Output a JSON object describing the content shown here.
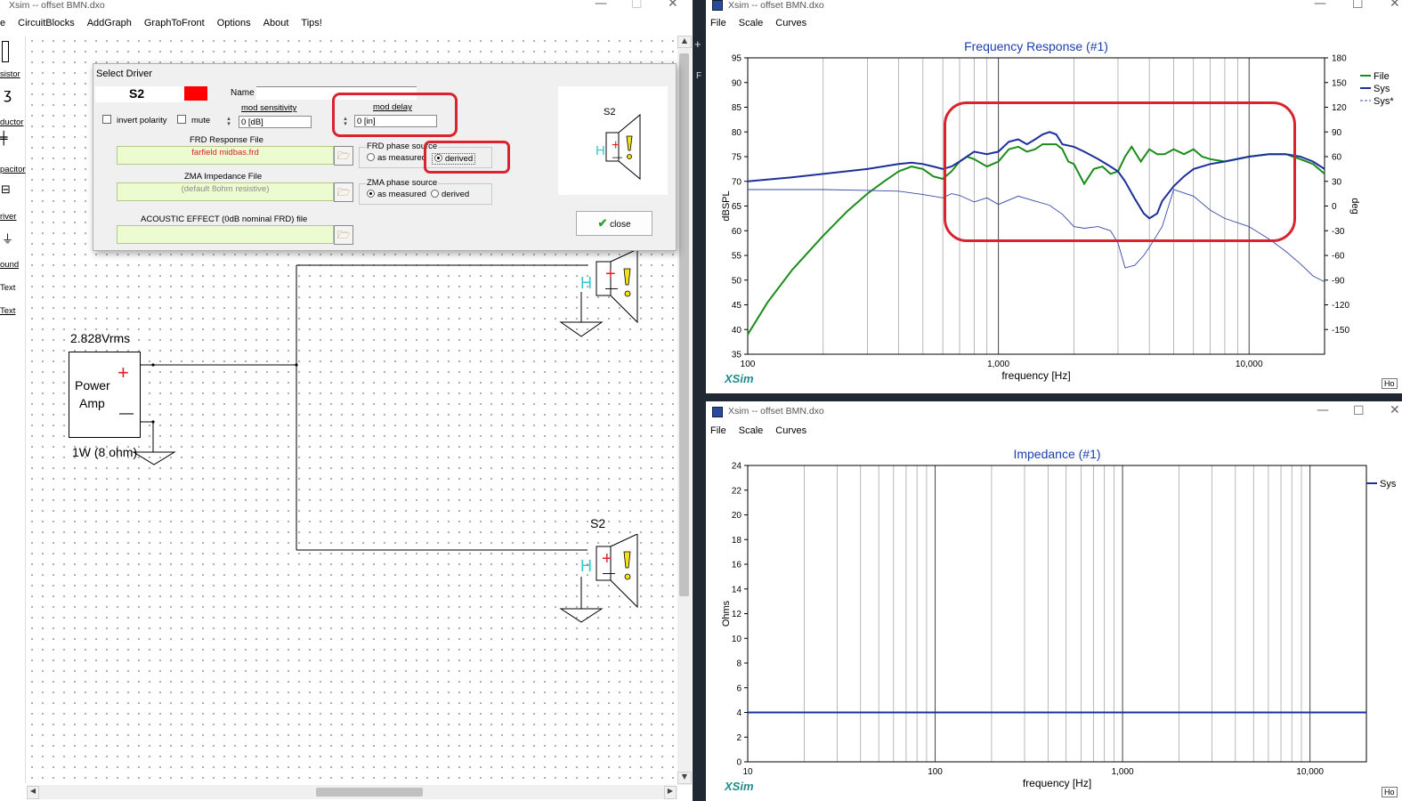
{
  "left_window": {
    "title": "Xsim -- offset BMN.dxo",
    "menu": [
      "e",
      "CircuitBlocks",
      "AddGraph",
      "GraphToFront",
      "Options",
      "About",
      "Tips!"
    ],
    "palette": [
      "sistor",
      "ductor",
      "pacitor",
      "river",
      "ound",
      "Text",
      "Text"
    ],
    "palette_plain_index": 5,
    "circuit": {
      "voltage_label": "2.828Vrms",
      "amp_line1": "Power",
      "amp_line2": "Amp",
      "plus": "+",
      "minus": "—",
      "power_label": "1W (8 ohm)",
      "driver2_label": "S2"
    }
  },
  "dialog": {
    "title": "Select Driver",
    "driver_name": "S2",
    "driver_color": "#ff0000",
    "name_label": "Name",
    "name_value": "",
    "invert_polarity_label": "invert polarity",
    "mute_label": "mute",
    "mod_sensitivity_label": "mod sensitivity",
    "mod_sensitivity_value": "0 [dB]",
    "mod_delay_label": "mod delay",
    "mod_delay_value": "0 [in]",
    "frd_label": "FRD Response File",
    "frd_value": "farfield midbas.frd",
    "frd_phase_label": "FRD phase source",
    "frd_phase_opt1": "as measured",
    "frd_phase_opt2": "derived",
    "frd_phase_selected": "derived",
    "zma_label": "ZMA Impedance File",
    "zma_value": "(default 8ohm resistive)",
    "zma_phase_label": "ZMA phase source",
    "zma_phase_opt1": "as measured",
    "zma_phase_opt2": "derived",
    "zma_phase_selected": "as measured",
    "acoustic_label": "ACOUSTIC EFFECT (0dB nominal FRD) file",
    "acoustic_value": "",
    "preview_label": "S2",
    "close_label": "close"
  },
  "fr_window": {
    "title": "Xsim -- offset BMN.dxo",
    "menu": [
      "File",
      "Scale",
      "Curves"
    ],
    "brand": "XSim",
    "corner_button": "Ho"
  },
  "imp_window": {
    "title": "Xsim -- offset BMN.dxo",
    "menu": [
      "File",
      "Scale",
      "Curves"
    ],
    "brand": "XSim",
    "corner_button": "Ho"
  },
  "colors": {
    "file_curve": "#1a8c1a",
    "sys_curve": "#1c2f9a",
    "title_blue": "#1a3fb0",
    "highlight_red": "#d9232e",
    "brand_teal": "#1e8b8b"
  },
  "chart_data": [
    {
      "type": "line",
      "title": "Frequency Response (#1)",
      "xlabel": "frequency [Hz]",
      "ylabel": "dBSPL",
      "y2label": "deg",
      "x_scale": "log",
      "xlim": [
        100,
        20000
      ],
      "ylim": [
        35,
        95
      ],
      "y2lim": [
        -180,
        180
      ],
      "xticks": [
        "100",
        "1,000",
        "10,000"
      ],
      "yticks": [
        35,
        40,
        45,
        50,
        55,
        60,
        65,
        70,
        75,
        80,
        85,
        90,
        95
      ],
      "y2ticks": [
        -150,
        -120,
        -90,
        -60,
        -30,
        0,
        30,
        60,
        90,
        120,
        150,
        180
      ],
      "grid": true,
      "legend_position": "right",
      "series": [
        {
          "name": "File",
          "axis": "y",
          "style": "solid",
          "x": [
            100,
            120,
            150,
            200,
            250,
            300,
            350,
            400,
            450,
            500,
            550,
            600,
            650,
            700,
            750,
            800,
            900,
            1000,
            1100,
            1200,
            1300,
            1400,
            1500,
            1600,
            1700,
            1800,
            1900,
            2000,
            2200,
            2400,
            2600,
            2800,
            3000,
            3200,
            3400,
            3700,
            4000,
            4300,
            4600,
            5000,
            5500,
            6000,
            6500,
            7000,
            8000,
            10000,
            12000,
            14000,
            16000,
            18000,
            20000
          ],
          "y": [
            39,
            45.5,
            52,
            59,
            64,
            67.5,
            70,
            72,
            73,
            72.5,
            71,
            70.5,
            72,
            74,
            75,
            74.5,
            73,
            74,
            76.5,
            77,
            76,
            76.5,
            77.5,
            77.5,
            77.5,
            76.5,
            74,
            73.5,
            69.5,
            72.5,
            73,
            71.5,
            72,
            75,
            77,
            74,
            76.5,
            75.5,
            75.5,
            76.5,
            75.5,
            76.5,
            75,
            74.5,
            74,
            75,
            75.5,
            75.5,
            74.5,
            73.5,
            71.5
          ]
        },
        {
          "name": "Sys",
          "axis": "y",
          "style": "solid",
          "x": [
            100,
            150,
            200,
            300,
            400,
            450,
            500,
            550,
            600,
            650,
            700,
            800,
            900,
            1000,
            1100,
            1200,
            1300,
            1400,
            1500,
            1600,
            1700,
            1800,
            2000,
            2200,
            2500,
            2800,
            3000,
            3200,
            3500,
            3800,
            4000,
            4300,
            4500,
            5000,
            5500,
            6000,
            7000,
            8000,
            10000,
            12000,
            14000,
            16000,
            18000,
            20000
          ],
          "y": [
            70,
            70.8,
            71.5,
            72.5,
            73.5,
            73.8,
            73.5,
            73,
            72.5,
            73,
            74,
            76,
            75.5,
            76,
            78,
            78.5,
            77.5,
            78.5,
            79.5,
            80,
            79.5,
            77.5,
            77,
            76,
            74.5,
            73,
            72,
            70,
            66.5,
            63.5,
            62.5,
            63.5,
            66,
            69,
            71,
            72.5,
            73.5,
            74,
            75,
            75.5,
            75.5,
            75,
            74,
            72.5
          ]
        },
        {
          "name": "Sys*",
          "axis": "y2",
          "style": "dashed",
          "x": [
            100,
            200,
            300,
            400,
            500,
            600,
            650,
            700,
            800,
            900,
            1000,
            1200,
            1400,
            1600,
            1800,
            2000,
            2200,
            2500,
            2800,
            3000,
            3200,
            3500,
            3800,
            4000,
            4500,
            5000,
            6000,
            7000,
            8000,
            10000,
            12000,
            14000,
            16000,
            18000,
            20000
          ],
          "y": [
            20,
            20,
            19,
            18,
            14,
            10,
            15,
            13,
            5,
            10,
            2,
            12,
            6,
            1,
            -10,
            -25,
            -27,
            -25,
            -30,
            -45,
            -75,
            -72,
            -60,
            -50,
            -25,
            20,
            12,
            -5,
            -15,
            -25,
            -40,
            -55,
            -70,
            -85,
            -92
          ]
        }
      ]
    },
    {
      "type": "line",
      "title": "Impedance (#1)",
      "xlabel": "frequency [Hz]",
      "ylabel": "Ohms",
      "x_scale": "log",
      "xlim": [
        10,
        20000
      ],
      "ylim": [
        0,
        24
      ],
      "xticks": [
        "10",
        "100",
        "1,000",
        "10,000"
      ],
      "yticks": [
        0,
        2,
        4,
        6,
        8,
        10,
        12,
        14,
        16,
        18,
        20,
        22,
        24
      ],
      "grid": true,
      "legend_position": "right",
      "series": [
        {
          "name": "Sys",
          "style": "solid",
          "x": [
            10,
            20000
          ],
          "y": [
            4,
            4
          ]
        }
      ]
    }
  ]
}
